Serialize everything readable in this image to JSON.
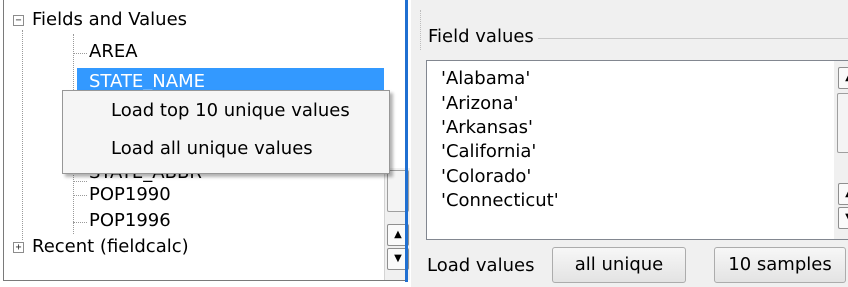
{
  "tree": {
    "root_label": "Fields and Values",
    "fields": [
      {
        "label": "AREA"
      },
      {
        "label": "STATE_NAME"
      },
      {
        "label": "STATE_ABBR"
      },
      {
        "label": "POP1990"
      },
      {
        "label": "POP1996"
      }
    ],
    "recent_label": "Recent (fieldcalc)",
    "expander_open": "−",
    "expander_closed": "+"
  },
  "context_menu": {
    "items": [
      {
        "label": "Load top 10 unique values"
      },
      {
        "label": "Load all unique values"
      }
    ]
  },
  "field_values": {
    "group_title": "Field values",
    "values": [
      "'Alabama'",
      "'Arizona'",
      "'Arkansas'",
      "'California'",
      "'Colorado'",
      "'Connecticut'"
    ],
    "load_label": "Load values",
    "all_unique_label": "all unique",
    "samples_label": "10 samples"
  },
  "colors": {
    "selection": "#3399ff",
    "focus_border": "#1f6fd1"
  }
}
